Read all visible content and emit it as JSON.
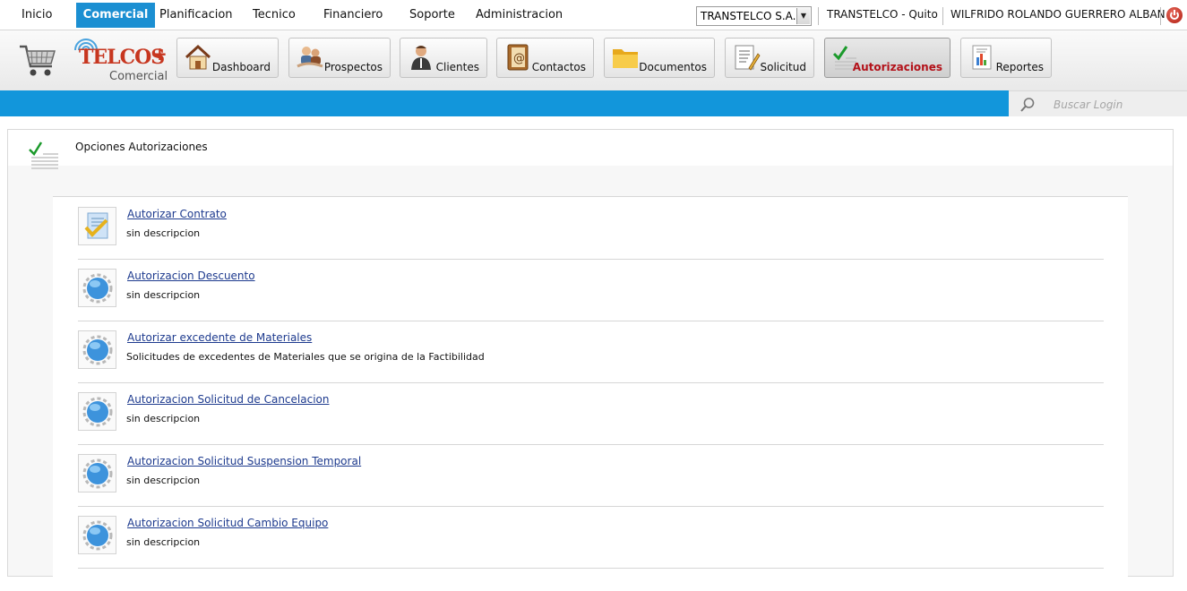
{
  "top_menu": {
    "items": [
      {
        "label": "Inicio"
      },
      {
        "label": "Comercial"
      },
      {
        "label": "Planificacion"
      },
      {
        "label": "Tecnico"
      },
      {
        "label": "Financiero"
      },
      {
        "label": "Soporte"
      },
      {
        "label": "Administracion"
      }
    ],
    "active_item": "Comercial",
    "company_select": "TRANSTELCO S.A.",
    "office": "TRANSTELCO - Quito",
    "user": "WILFRIDO ROLANDO GUERRERO ALBAN"
  },
  "toolbar": {
    "logo_text": "TELCOS",
    "logo_plus": "+",
    "logo_subtitle": "Comercial",
    "modules": [
      {
        "label": "Dashboard",
        "icon": "house-icon"
      },
      {
        "label": "Prospectos",
        "icon": "prospects-icon"
      },
      {
        "label": "Clientes",
        "icon": "client-icon"
      },
      {
        "label": "Contactos",
        "icon": "address-book-icon"
      },
      {
        "label": "Documentos",
        "icon": "folder-icon"
      },
      {
        "label": "Solicitud",
        "icon": "request-icon"
      },
      {
        "label": "Autorizaciones",
        "icon": "checklist-icon"
      },
      {
        "label": "Reportes",
        "icon": "report-icon"
      }
    ],
    "active_module": "Autorizaciones"
  },
  "search": {
    "placeholder": "Buscar Login"
  },
  "panel": {
    "title": "Opciones Autorizaciones",
    "options": [
      {
        "label": "Autorizar Contrato",
        "description": "sin descripcion",
        "icon": "contract-check-icon"
      },
      {
        "label": "Autorizacion Descuento",
        "description": "sin descripcion",
        "icon": "globe-gear-icon"
      },
      {
        "label": "Autorizar excedente de Materiales",
        "description": "Solicitudes de excedentes de Materiales que se origina de la Factibilidad",
        "icon": "globe-gear-icon"
      },
      {
        "label": "Autorizacion Solicitud de Cancelacion",
        "description": "sin descripcion",
        "icon": "globe-gear-icon"
      },
      {
        "label": "Autorizacion Solicitud Suspension Temporal",
        "description": "sin descripcion",
        "icon": "globe-gear-icon"
      },
      {
        "label": "Autorizacion Solicitud Cambio Equipo",
        "description": "sin descripcion",
        "icon": "globe-gear-icon"
      }
    ]
  },
  "colors": {
    "accent_blue": "#1296db",
    "active_menu": "#1b8fd2",
    "active_module_text": "#b3121a",
    "link": "#1d3a8e"
  }
}
